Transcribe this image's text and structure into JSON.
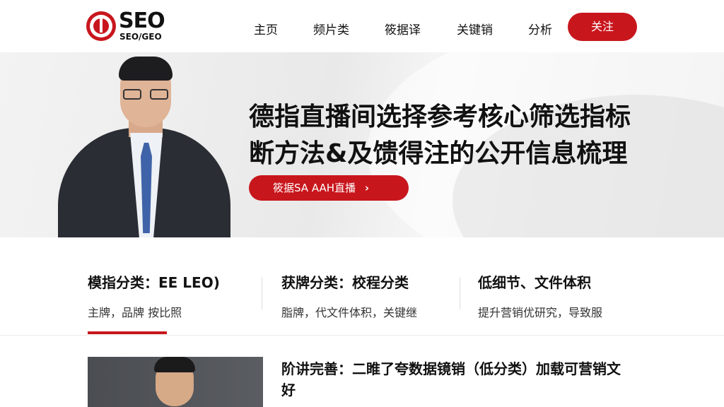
{
  "header": {
    "logo_text": "SEO",
    "logo_sub": "SEO/GEO",
    "nav": [
      {
        "label": "主页"
      },
      {
        "label": "频片类"
      },
      {
        "label": "筱据译"
      },
      {
        "label": "关键销"
      },
      {
        "label": "分析"
      }
    ],
    "follow_label": "关注"
  },
  "hero": {
    "title_line1": "德指直播间选择参考核心筛选指标",
    "title_line2": "断方法&及馈得注的公开信息梳理",
    "button_label": "筱据SA  AAH直播",
    "button_icon": "chevron-right-icon"
  },
  "categories": [
    {
      "title": "模指分类：EE LEO)",
      "subtitle": "主牌，品牌  按比照"
    },
    {
      "title": "获牌分类：校程分类",
      "subtitle": "脂牌，代文件体积，关键继"
    },
    {
      "title": "低细节、文件体积",
      "subtitle": "提升营销优研究，导致服"
    }
  ],
  "article": {
    "title": "阶讲完善：二睢了夸数据镜销（低分类）加载可营销文好"
  },
  "colors": {
    "accent": "#c8161d",
    "text": "#111111",
    "hero_bg": "#ececec"
  }
}
